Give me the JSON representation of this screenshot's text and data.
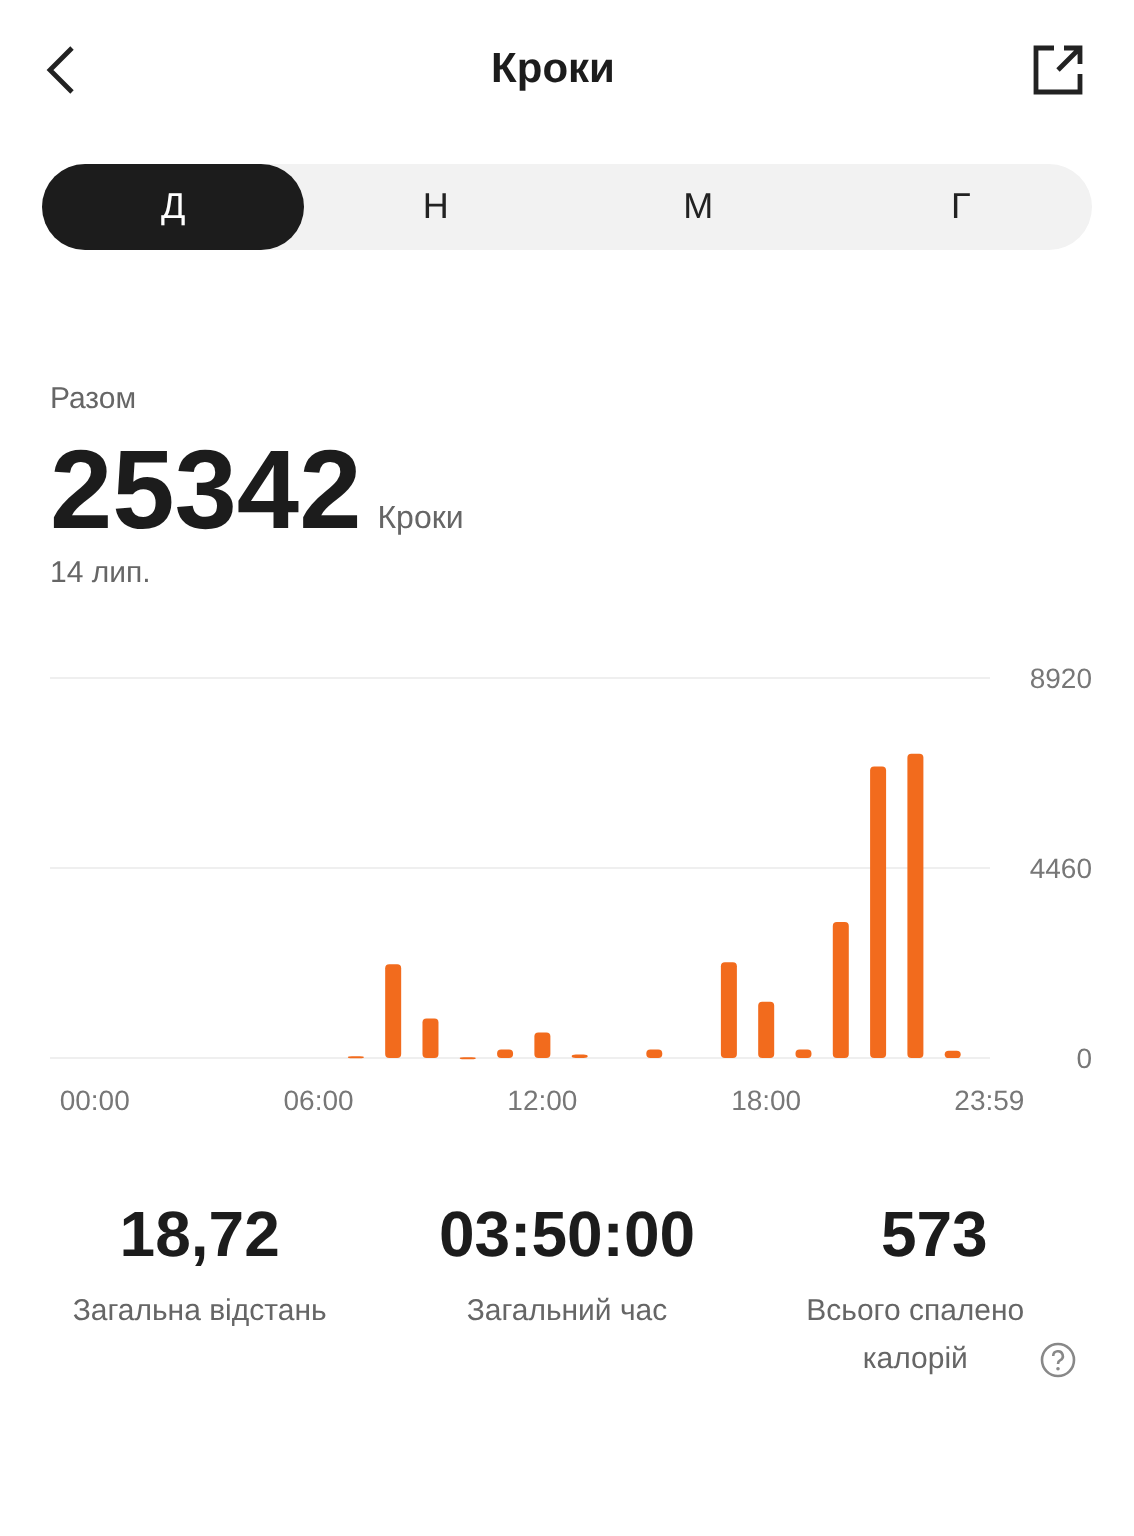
{
  "header": {
    "title": "Кроки"
  },
  "tabs": [
    {
      "label": "Д",
      "selected": true
    },
    {
      "label": "Н",
      "selected": false
    },
    {
      "label": "М",
      "selected": false
    },
    {
      "label": "Г",
      "selected": false
    }
  ],
  "summary": {
    "label": "Разом",
    "value": "25342",
    "unit": "Кроки",
    "date": "14 лип."
  },
  "chart_data": {
    "type": "bar",
    "x": [
      0,
      1,
      2,
      3,
      4,
      5,
      6,
      7,
      8,
      9,
      10,
      11,
      12,
      13,
      14,
      15,
      16,
      17,
      18,
      19,
      20,
      21,
      22,
      23
    ],
    "series": [
      {
        "color": "#f26b1d",
        "values": [
          0,
          0,
          0,
          0,
          0,
          0,
          0,
          40,
          2200,
          930,
          20,
          200,
          600,
          80,
          0,
          200,
          0,
          2250,
          1320,
          200,
          3190,
          6840,
          7140,
          170
        ]
      }
    ],
    "xlim": [
      -1.2,
      24
    ],
    "ylim": [
      0,
      8920
    ],
    "yticks": [
      0,
      4460,
      8920
    ],
    "xticks": [
      {
        "value": 0,
        "label": "00:00"
      },
      {
        "value": 6,
        "label": "06:00"
      },
      {
        "value": 12,
        "label": "12:00"
      },
      {
        "value": 18,
        "label": "18:00"
      },
      {
        "value": 23.983,
        "label": "23:59"
      }
    ]
  },
  "stats": [
    {
      "value": "18,72",
      "label": "Загальна відстань",
      "info": false
    },
    {
      "value": "03:50:00",
      "label": "Загальний час",
      "info": false
    },
    {
      "value": "573",
      "label": "Всього спалено калорій",
      "info": true
    }
  ]
}
